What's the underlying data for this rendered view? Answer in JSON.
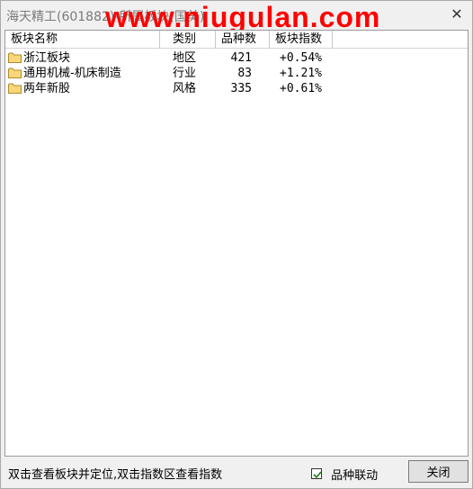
{
  "window": {
    "title": "海天精工(601882)-所属板块(国美)",
    "watermark": "www.niugulan.com",
    "close_glyph": "✕"
  },
  "table": {
    "columns": [
      "板块名称",
      "类别",
      "品种数",
      "板块指数"
    ],
    "rows": [
      {
        "name": "浙江板块",
        "type": "地区",
        "count": "421",
        "index": "+0.54%"
      },
      {
        "name": "通用机械-机床制造",
        "type": "行业",
        "count": "83",
        "index": "+1.21%"
      },
      {
        "name": "两年新股",
        "type": "风格",
        "count": "335",
        "index": "+0.61%"
      }
    ],
    "row_icon": "folder-icon"
  },
  "footer": {
    "hint": "双击查看板块并定位,双击指数区查看指数",
    "linkage_label": "品种联动",
    "linkage_checked": true,
    "close_label": "关闭"
  },
  "colors": {
    "watermark": "#ff0000",
    "folder_fill": "#f7d77a",
    "folder_stroke": "#b08a2a",
    "check": "#1a7a1a"
  }
}
